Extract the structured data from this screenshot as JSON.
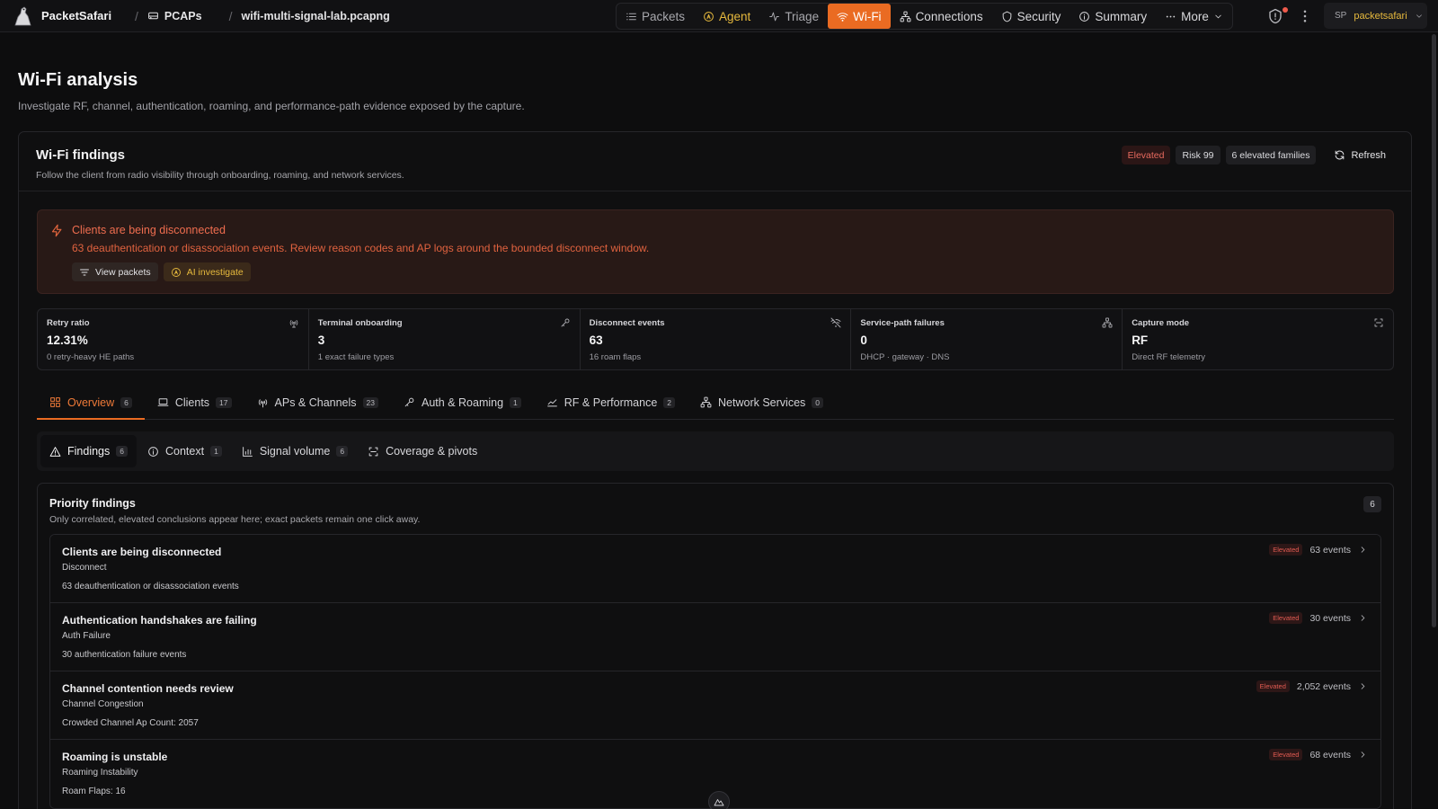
{
  "app": {
    "name": "PacketSafari",
    "breadcrumb": {
      "section": "PCAPs",
      "file": "wifi-multi-signal-lab.pcapng"
    }
  },
  "nav": {
    "items": [
      {
        "label": "Packets",
        "icon": "list-icon"
      },
      {
        "label": "Agent",
        "icon": "agent-icon"
      },
      {
        "label": "Triage",
        "icon": "pulse-icon"
      },
      {
        "label": "Wi-Fi",
        "icon": "wifi-icon"
      },
      {
        "label": "Connections",
        "icon": "network-icon"
      },
      {
        "label": "Security",
        "icon": "shield-icon"
      },
      {
        "label": "Summary",
        "icon": "info-icon"
      },
      {
        "label": "More",
        "icon": "ellipsis-icon"
      }
    ],
    "active": "Wi-Fi"
  },
  "user": {
    "initials": "SP",
    "name": "packetsafari"
  },
  "page": {
    "title": "Wi-Fi analysis",
    "subtitle": "Investigate RF, channel, authentication, roaming, and performance-path evidence exposed by the capture."
  },
  "findings_card": {
    "title": "Wi-Fi findings",
    "subtitle": "Follow the client from radio visibility through onboarding, roaming, and network services.",
    "pills": {
      "severity": "Elevated",
      "risk": "Risk 99",
      "families": "6 elevated families"
    },
    "refresh_label": "Refresh",
    "colors": {
      "accent": "#ea6b22",
      "elevated": "#e76a5e",
      "amber": "#e6b93d"
    }
  },
  "alert": {
    "title": "Clients are being disconnected",
    "text": "63 deauthentication or disassociation events. Review reason codes and AP logs around the bounded disconnect window.",
    "view_packets": "View packets",
    "ai_investigate": "AI investigate"
  },
  "metrics": [
    {
      "label": "Retry ratio",
      "value": "12.31%",
      "sub": "0 retry-heavy HE paths",
      "icon": "antenna-icon"
    },
    {
      "label": "Terminal onboarding",
      "value": "3",
      "sub": "1 exact failure types",
      "icon": "key-icon"
    },
    {
      "label": "Disconnect events",
      "value": "63",
      "sub": "16 roam flaps",
      "icon": "wifi-off-icon"
    },
    {
      "label": "Service-path failures",
      "value": "0",
      "sub": "DHCP · gateway · DNS",
      "icon": "network-icon"
    },
    {
      "label": "Capture mode",
      "value": "RF",
      "sub": "Direct RF telemetry",
      "icon": "scan-icon"
    }
  ],
  "tabs": [
    {
      "label": "Overview",
      "count": "6"
    },
    {
      "label": "Clients",
      "count": "17"
    },
    {
      "label": "APs & Channels",
      "count": "23"
    },
    {
      "label": "Auth & Roaming",
      "count": "1"
    },
    {
      "label": "RF & Performance",
      "count": "2"
    },
    {
      "label": "Network Services",
      "count": "0"
    }
  ],
  "subtabs": [
    {
      "label": "Findings",
      "count": "6"
    },
    {
      "label": "Context",
      "count": "1"
    },
    {
      "label": "Signal volume",
      "count": "6"
    },
    {
      "label": "Coverage & pivots",
      "count": ""
    }
  ],
  "priority": {
    "title": "Priority findings",
    "subtitle": "Only correlated, elevated conclusions appear here; exact packets remain one click away.",
    "count": "6",
    "items": [
      {
        "title": "Clients are being disconnected",
        "category": "Disconnect",
        "detail": "63 deauthentication or disassociation events",
        "badge": "Elevated",
        "events": "63 events"
      },
      {
        "title": "Authentication handshakes are failing",
        "category": "Auth Failure",
        "detail": "30 authentication failure events",
        "badge": "Elevated",
        "events": "30 events"
      },
      {
        "title": "Channel contention needs review",
        "category": "Channel Congestion",
        "detail": "Crowded Channel Ap Count: 2057",
        "badge": "Elevated",
        "events": "2,052 events"
      },
      {
        "title": "Roaming is unstable",
        "category": "Roaming Instability",
        "detail": "Roam Flaps: 16",
        "badge": "Elevated",
        "events": "68 events"
      }
    ]
  }
}
